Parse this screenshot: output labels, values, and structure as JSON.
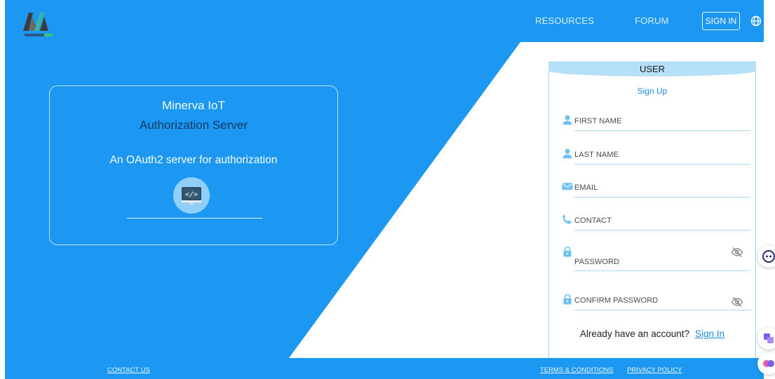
{
  "colors": {
    "accent": "#1c98f2",
    "link": "#1c8ae0",
    "panel_border": "#9cd3f5"
  },
  "header": {
    "logo_icon": "minerva-logo",
    "nav": [
      {
        "label": "RESOURCES"
      },
      {
        "label": "FORUM"
      }
    ],
    "sign_in_label": "SIGN IN",
    "language_icon": "globe-icon"
  },
  "info": {
    "title": "Minerva IoT",
    "subtitle": "Authorization Server",
    "description": "An OAuth2 server for authorization",
    "icon": "code-monitor-icon"
  },
  "form": {
    "tab_label": "USER",
    "heading": "Sign Up",
    "fields": [
      {
        "label": "FIRST NAME",
        "icon": "person-icon"
      },
      {
        "label": "LAST NAME",
        "icon": "person-icon"
      },
      {
        "label": "EMAIL",
        "icon": "envelope-icon"
      },
      {
        "label": "CONTACT",
        "icon": "phone-icon"
      },
      {
        "label": "PASSWORD",
        "icon": "lock-icon",
        "toggle_icon": "eye-off-icon"
      },
      {
        "label": "CONFIRM PASSWORD",
        "icon": "lock-icon",
        "toggle_icon": "eye-off-icon"
      }
    ],
    "have_account_text": "Already have an account?",
    "sign_in_link": "Sign In"
  },
  "footer": {
    "contact_us": "CONTACT US",
    "terms": "TERMS & CONDITIONS",
    "privacy": "PRIVACY POLICY"
  },
  "floating": [
    {
      "icon": "chat-assistant-icon"
    },
    {
      "icon": "translate-icon"
    },
    {
      "icon": "brain-icon"
    }
  ]
}
